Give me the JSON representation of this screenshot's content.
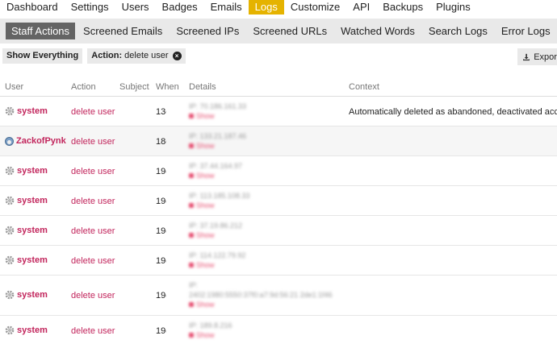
{
  "nav": {
    "items": [
      "Dashboard",
      "Settings",
      "Users",
      "Badges",
      "Emails",
      "Logs",
      "Customize",
      "API",
      "Backups",
      "Plugins"
    ],
    "active_index": 5
  },
  "subnav": {
    "items": [
      "Staff Actions",
      "Screened Emails",
      "Screened IPs",
      "Screened URLs",
      "Watched Words",
      "Search Logs",
      "Error Logs"
    ],
    "active_index": 0
  },
  "filters": {
    "show_everything": "Show Everything",
    "chip_label": "Action:",
    "chip_value": "delete user"
  },
  "export_label": "Export",
  "table": {
    "columns": [
      "User",
      "Action",
      "Subject",
      "When",
      "Details",
      "Context"
    ],
    "rows": [
      {
        "user": "system",
        "avatar": "gear",
        "action": "delete user",
        "when": "13d",
        "ip": "IP: 70.186.161.33",
        "link": "Show",
        "context": "Automatically deleted as abandoned, deactivated account"
      },
      {
        "user": "ZackofPynk",
        "avatar": "photo",
        "action": "delete user",
        "when": "18d",
        "ip": "IP: 133.21.187.46",
        "link": "Show",
        "context": ""
      },
      {
        "user": "system",
        "avatar": "gear",
        "action": "delete user",
        "when": "19d",
        "ip": "IP: 37.44.164.97",
        "link": "Show",
        "context": ""
      },
      {
        "user": "system",
        "avatar": "gear",
        "action": "delete user",
        "when": "19d",
        "ip": "IP: 113.185.108.33",
        "link": "Show",
        "context": ""
      },
      {
        "user": "system",
        "avatar": "gear",
        "action": "delete user",
        "when": "19d",
        "ip": "IP: 37.19.86.212",
        "link": "Show",
        "context": ""
      },
      {
        "user": "system",
        "avatar": "gear",
        "action": "delete user",
        "when": "19d",
        "ip": "IP: 114.122.79.92",
        "link": "Show",
        "context": ""
      },
      {
        "user": "system",
        "avatar": "gear",
        "action": "delete user",
        "when": "19d",
        "ip": "IP:",
        "ip2": "2402:1980:5550:37f0:a7:9d:56:21 2de1:1f46",
        "link": "Show",
        "context": ""
      },
      {
        "user": "system",
        "avatar": "gear",
        "action": "delete user",
        "when": "19d",
        "ip": "IP: 189.8.216",
        "link": "Show",
        "context": ""
      }
    ]
  }
}
